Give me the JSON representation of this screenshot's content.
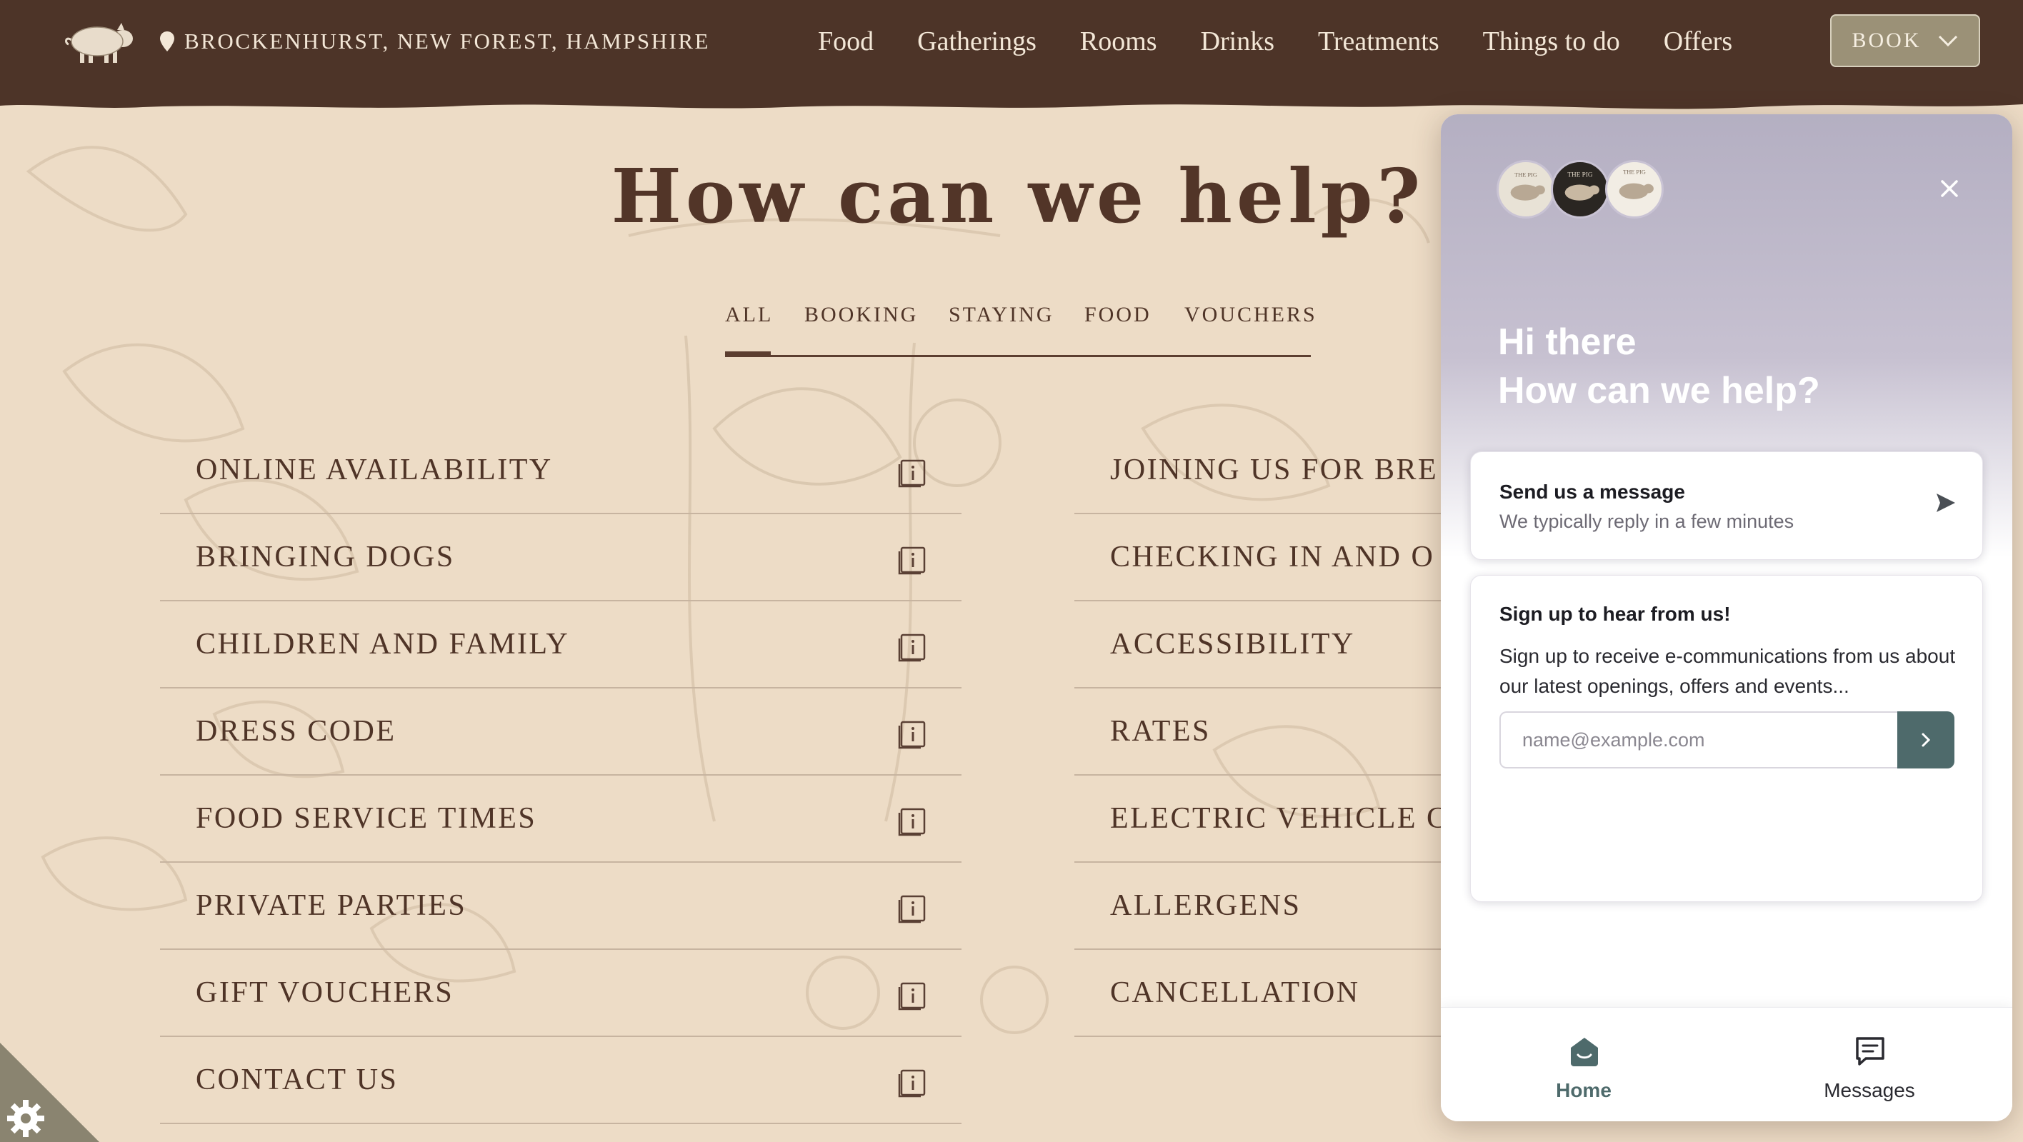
{
  "header": {
    "location": "BROCKENHURST, NEW FOREST, HAMPSHIRE",
    "nav": [
      "Food",
      "Gatherings",
      "Rooms",
      "Drinks",
      "Treatments",
      "Things to do",
      "Offers"
    ],
    "book_label": "BOOK"
  },
  "main": {
    "title": "How can we help?",
    "tabs": [
      "ALL",
      "BOOKING",
      "STAYING",
      "FOOD",
      "VOUCHERS"
    ],
    "active_tab": "ALL",
    "faq_left": [
      "ONLINE AVAILABILITY",
      "BRINGING DOGS",
      "CHILDREN AND FAMILY",
      "DRESS CODE",
      "FOOD SERVICE TIMES",
      "PRIVATE PARTIES",
      "GIFT VOUCHERS",
      "CONTACT US"
    ],
    "faq_right": [
      "JOINING US FOR BRE",
      "CHECKING IN AND O",
      "ACCESSIBILITY",
      "RATES",
      "ELECTRIC VEHICLE C",
      "ALLERGENS",
      "CANCELLATION"
    ]
  },
  "widget": {
    "greeting_line1": "Hi there",
    "greeting_line2": "How can we help?",
    "message_card": {
      "title": "Send us a message",
      "subtitle": "We typically reply in a few minutes"
    },
    "signup_card": {
      "title": "Sign up to hear from us!",
      "body": "Sign up to receive e-communications from us about our latest openings, offers and events...",
      "email_placeholder": "name@example.com"
    },
    "footer_tabs": [
      "Home",
      "Messages"
    ],
    "avatar_text": "THE PIG"
  },
  "colors": {
    "header_bg": "#4d3428",
    "page_bg": "#eddcc6",
    "book_button": "#9b9177",
    "widget_accent": "#4e6a6b",
    "widget_header": "#b4afc2"
  }
}
